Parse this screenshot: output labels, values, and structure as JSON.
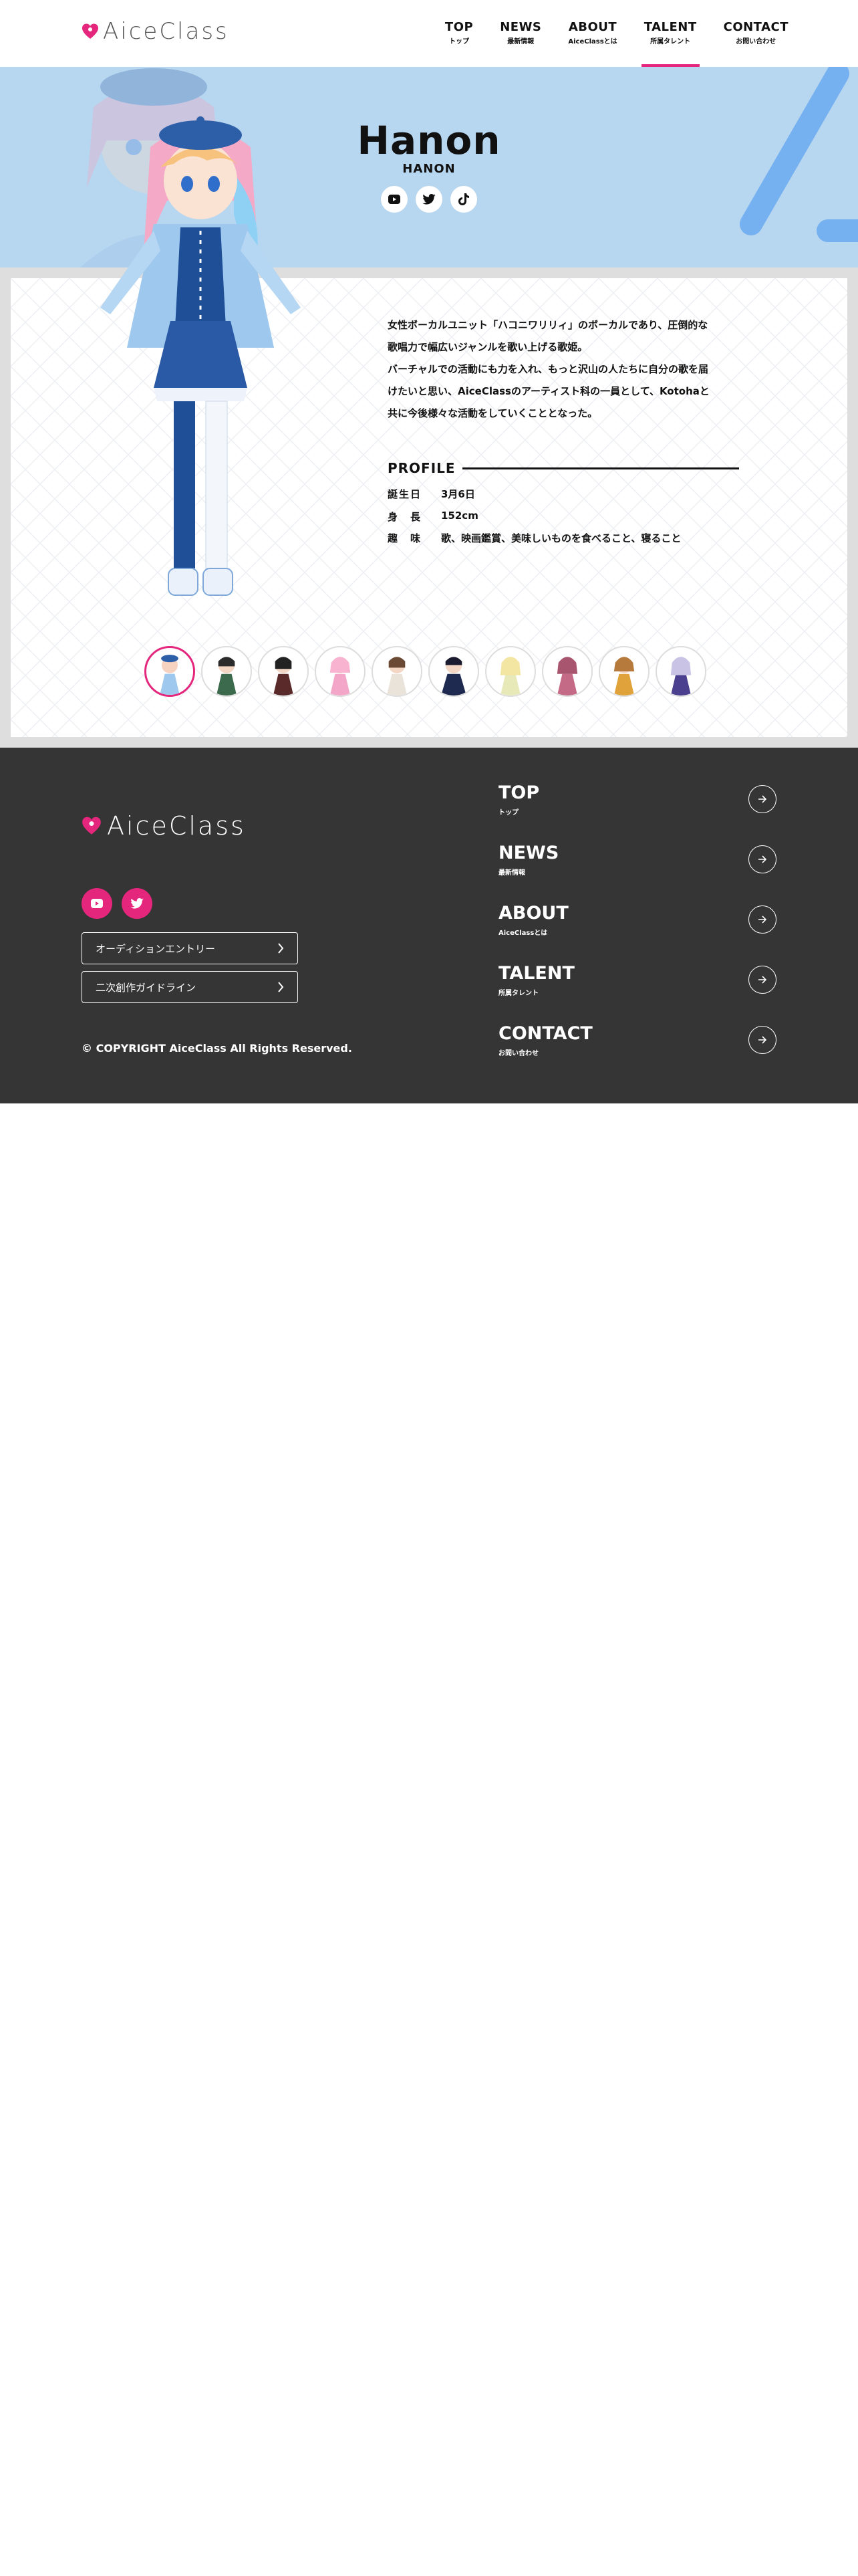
{
  "header": {
    "logo_text": "AiceClass",
    "nav": [
      {
        "en": "TOP",
        "ja": "トップ"
      },
      {
        "en": "NEWS",
        "ja": "最新情報"
      },
      {
        "en": "ABOUT",
        "ja": "AiceClassとは"
      },
      {
        "en": "TALENT",
        "ja": "所属タレント"
      },
      {
        "en": "CONTACT",
        "ja": "お問い合わせ"
      }
    ],
    "active_nav": "TALENT"
  },
  "hero": {
    "name": "Hanon",
    "name_upper": "HANON",
    "social_icons": [
      "youtube-icon",
      "twitter-icon",
      "tiktok-icon"
    ],
    "bg_color": "#b7d6f0"
  },
  "talent": {
    "description": [
      "女性ボーカルユニット「ハコニワリリィ」のボーカルであり、圧倒的な",
      "歌唱力で幅広いジャンルを歌い上げる歌姫。",
      "バーチャルでの活動にも力を入れ、もっと沢山の人たちに自分の歌を届",
      "けたいと思い、AiceClassのアーティスト科の一員として、Kotohaと",
      "共に今後様々な活動をしていくこととなった。"
    ],
    "profile_title": "PROFILE",
    "profile": [
      {
        "key": "誕生日",
        "value": "3月6日"
      },
      {
        "key": "身　長",
        "value": "152cm"
      },
      {
        "key": "趣　味",
        "value": "歌、映画鑑賞、美味しいものを食べること、寝ること"
      }
    ],
    "thumbnail_count": 10,
    "active_thumbnail": 0
  },
  "footer": {
    "logo_text": "AiceClass",
    "social_icons": [
      "youtube-icon",
      "twitter-icon"
    ],
    "buttons": [
      "オーディションエントリー",
      "二次創作ガイドライン"
    ],
    "copyright": "© COPYRIGHT AiceClass All Rights Reserved.",
    "nav": [
      {
        "en": "TOP",
        "ja": "トップ"
      },
      {
        "en": "NEWS",
        "ja": "最新情報"
      },
      {
        "en": "ABOUT",
        "ja": "AiceClassとは"
      },
      {
        "en": "TALENT",
        "ja": "所属タレント"
      },
      {
        "en": "CONTACT",
        "ja": "お問い合わせ"
      }
    ]
  },
  "colors": {
    "accent": "#e5267d",
    "footer_bg": "#353535",
    "hero_bg": "#b7d6f0"
  }
}
